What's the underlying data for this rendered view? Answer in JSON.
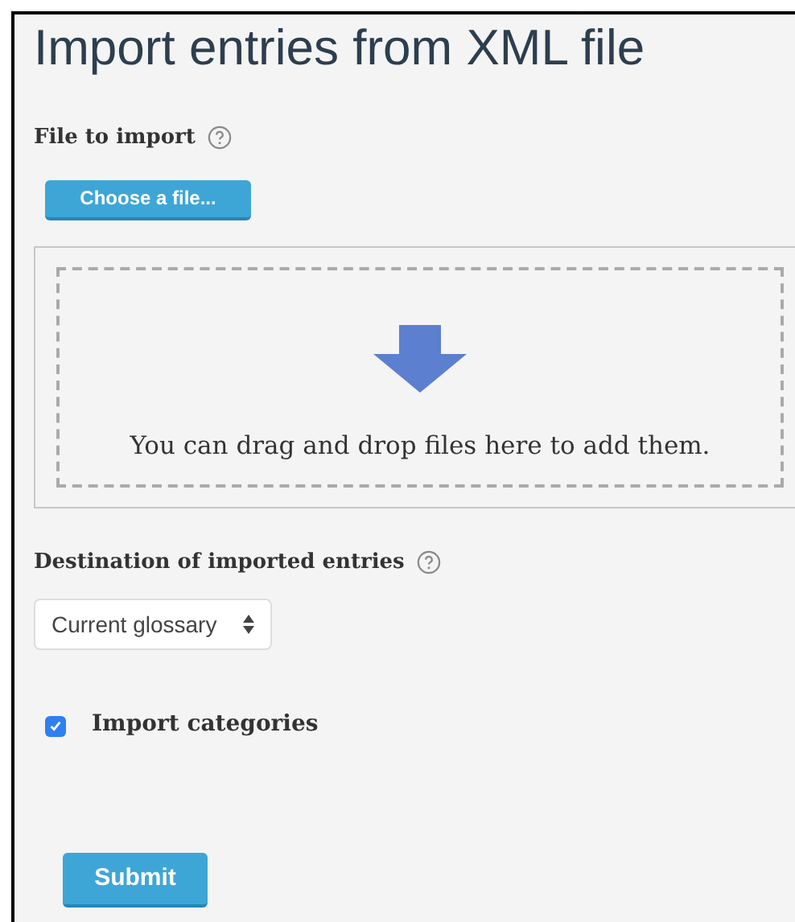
{
  "title": "Import entries from XML file",
  "file_field": {
    "label": "File to import",
    "button": "Choose a file...",
    "drop_hint": "You can drag and drop files here to add them."
  },
  "destination": {
    "label": "Destination of imported entries",
    "value": "Current glossary"
  },
  "import_categories": {
    "label": "Import categories",
    "checked": true
  },
  "submit": "Submit"
}
